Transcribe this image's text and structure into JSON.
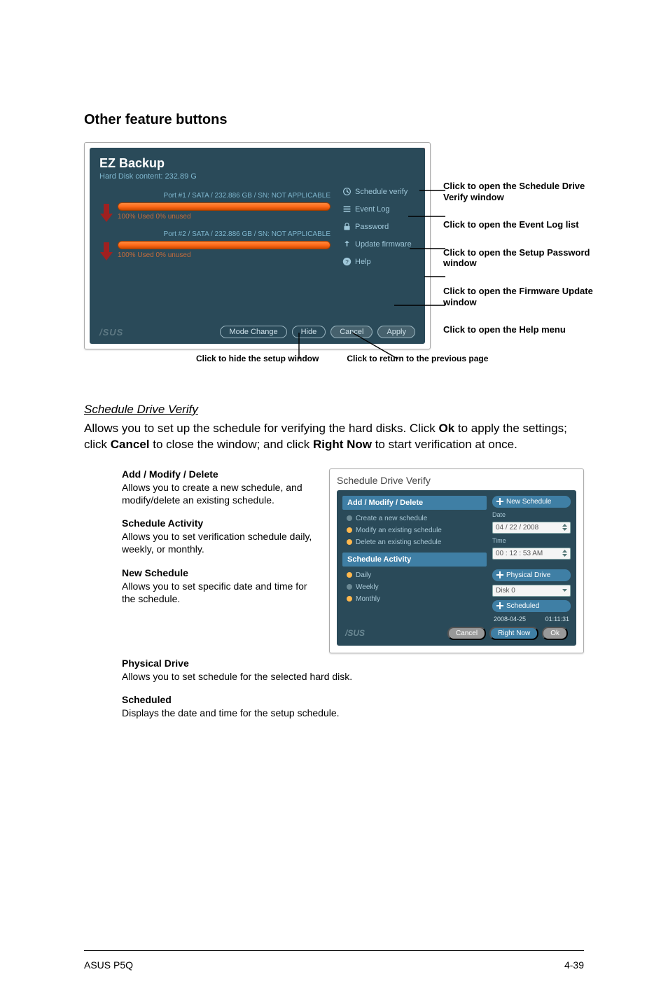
{
  "section_title": "Other feature buttons",
  "ez_backup": {
    "title": "EZ Backup",
    "subtitle": "Hard Disk content: 232.89 G",
    "port1": "Port #1 / SATA / 232.886 GB / SN: NOT APPLICABLE",
    "port2": "Port #2 / SATA / 232.886 GB / SN: NOT APPLICABLE",
    "bar1_text": "100% Used 0% unused",
    "bar2_text": "100% Used 0% unused",
    "side": {
      "schedule_verify": "Schedule verify",
      "event_log": "Event Log",
      "password": "Password",
      "update_firmware": "Update firmware",
      "help": "Help"
    },
    "footer": {
      "mode_change": "Mode Change",
      "hide": "Hide",
      "cancel": "Cancel",
      "apply": "Apply",
      "logo": "/SUS"
    }
  },
  "callouts": {
    "c1": "Click to open the Schedule Drive Verify window",
    "c2": "Click to open the Event Log list",
    "c3": "Click to open the Setup Password window",
    "c4": "Click to open the Firmware Update window",
    "c5": "Click to open the Help menu"
  },
  "under": {
    "hide": "Click to hide the setup window",
    "cancel": "Click to return to the previous page"
  },
  "sdv_head": "Schedule Drive Verify",
  "sdv_para_1": "Allows you to set up the schedule for verifying the hard disks. Click ",
  "sdv_para_ok": "Ok",
  "sdv_para_2": " to apply the settings; click ",
  "sdv_para_cancel": "Cancel",
  "sdv_para_3": " to close the window; and click ",
  "sdv_para_rightnow": "Right Now",
  "sdv_para_4": " to start verification at once.",
  "defs": {
    "amd_h": "Add / Modify / Delete",
    "amd_p": "Allows you to create a new schedule, and modify/delete an existing schedule.",
    "sa_h": "Schedule Activity",
    "sa_p": "Allows you to set verification schedule daily, weekly, or monthly.",
    "ns_h": "New Schedule",
    "ns_p": "Allows you to set specific date and time for the schedule.",
    "pd_h": "Physical Drive",
    "pd_p": "Allows you to set schedule for the selected hard disk.",
    "sch_h": "Scheduled",
    "sch_p": "Displays the date and time for the setup schedule."
  },
  "sdv_dialog": {
    "title": "Schedule Drive Verify",
    "amd_header": "Add / Modify / Delete",
    "opt_create": "Create a new schedule",
    "opt_modify": "Modify an existing schedule",
    "opt_delete": "Delete an existing schedule",
    "sa_header": "Schedule Activity",
    "opt_daily": "Daily",
    "opt_weekly": "Weekly",
    "opt_monthly": "Monthly",
    "new_schedule": "New Schedule",
    "date_label": "Date",
    "date_value": "04 / 22 / 2008",
    "time_label": "Time",
    "time_value": "00 : 12 : 53 AM",
    "physical_drive": "Physical Drive",
    "disk": "Disk 0",
    "scheduled": "Scheduled",
    "sched_date": "2008-04-25",
    "sched_time": "01:11:31",
    "logo": "/SUS",
    "cancel": "Cancel",
    "right_now": "Right Now",
    "ok": "Ok"
  },
  "footer": {
    "left": "ASUS P5Q",
    "right": "4-39"
  }
}
